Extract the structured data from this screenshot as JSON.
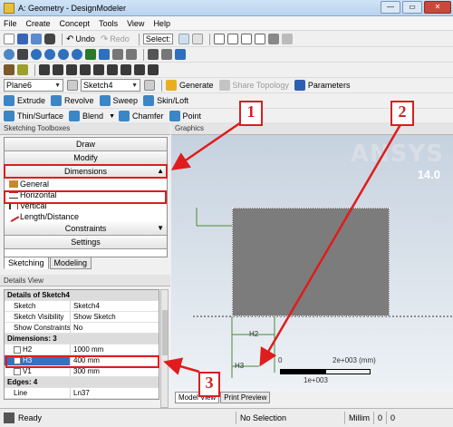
{
  "window": {
    "title": "A: Geometry - DesignModeler",
    "min": "—",
    "max": "▭",
    "close": "✕"
  },
  "menu": [
    "File",
    "Create",
    "Concept",
    "Tools",
    "View",
    "Help"
  ],
  "toolbar1": {
    "undo": "Undo",
    "redo": "Redo",
    "select": "Select:"
  },
  "toolbar4": {
    "plane": "Plane6",
    "sketch": "Sketch4",
    "generate": "Generate",
    "share": "Share Topology",
    "parameters": "Parameters"
  },
  "toolbar5": {
    "extrude": "Extrude",
    "revolve": "Revolve",
    "sweep": "Sweep",
    "skin": "Skin/Loft"
  },
  "toolbar6": {
    "thin": "Thin/Surface",
    "blend": "Blend",
    "chamfer": "Chamfer",
    "point": "Point"
  },
  "sketching": {
    "header": "Sketching Toolboxes",
    "sections": {
      "draw": "Draw",
      "modify": "Modify",
      "dimensions": "Dimensions",
      "constraints": "Constraints",
      "settings": "Settings"
    },
    "items": [
      "General",
      "Horizontal",
      "Vertical",
      "Length/Distance"
    ],
    "tabs": [
      "Sketching",
      "Modeling"
    ]
  },
  "details": {
    "header": "Details View",
    "group1": "Details of Sketch4",
    "rows1": [
      {
        "k": "Sketch",
        "v": "Sketch4"
      },
      {
        "k": "Sketch Visibility",
        "v": "Show Sketch"
      },
      {
        "k": "Show Constraints?",
        "v": "No"
      }
    ],
    "group2": "Dimensions: 3",
    "dims": [
      {
        "k": "H2",
        "v": "1000 mm"
      },
      {
        "k": "H3",
        "v": "400 mm"
      },
      {
        "k": "V1",
        "v": "300 mm"
      }
    ],
    "group3": "Edges: 4",
    "rows3": [
      {
        "k": "Line",
        "v": "Ln37"
      }
    ]
  },
  "graphics": {
    "header": "Graphics",
    "logo": "ANSYS",
    "version": "14.0",
    "dim_h2": "H2",
    "dim_h3": "H3",
    "scale_start": "0",
    "scale_end": "2e+003 (mm)",
    "scale_mid": "1e+003",
    "tabs": [
      "Model View",
      "Print Preview"
    ]
  },
  "status": {
    "ready": "Ready",
    "selection": "No Selection",
    "units": "Millim",
    "v1": "0",
    "v2": "0"
  },
  "callouts": [
    "1",
    "2",
    "3"
  ],
  "colors": {
    "annotation": "#e01c1c",
    "selection": "#3571c4",
    "sketch_fill": "#7c7c7c"
  }
}
